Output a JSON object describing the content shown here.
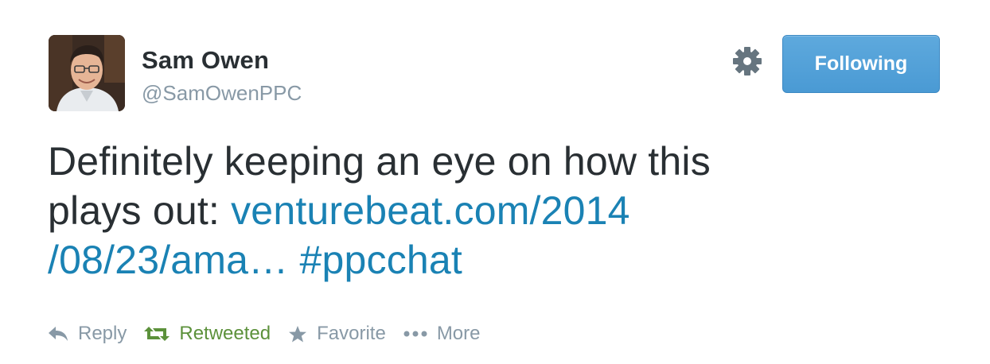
{
  "user": {
    "display_name": "Sam Owen",
    "handle": "@SamOwenPPC"
  },
  "follow_button": {
    "label": "Following"
  },
  "tweet": {
    "text_line1": "Definitely keeping an eye on how this",
    "text_line2_plain": "plays out: ",
    "link_part1": "venturebeat.com/2014",
    "link_part2": "/08/23/ama…",
    "hashtag": "#ppcchat"
  },
  "actions": {
    "reply": "Reply",
    "retweet": "Retweeted",
    "favorite": "Favorite",
    "more": "More"
  },
  "icons": {
    "settings": "gear-icon",
    "reply": "reply-arrow-icon",
    "retweet": "retweet-icon",
    "favorite": "star-icon",
    "more": "ellipsis-icon"
  },
  "colors": {
    "link": "#1a82b4",
    "retweeted": "#5c913b",
    "follow_button": "#55a3da",
    "muted": "#8899a6",
    "text": "#292f33"
  }
}
